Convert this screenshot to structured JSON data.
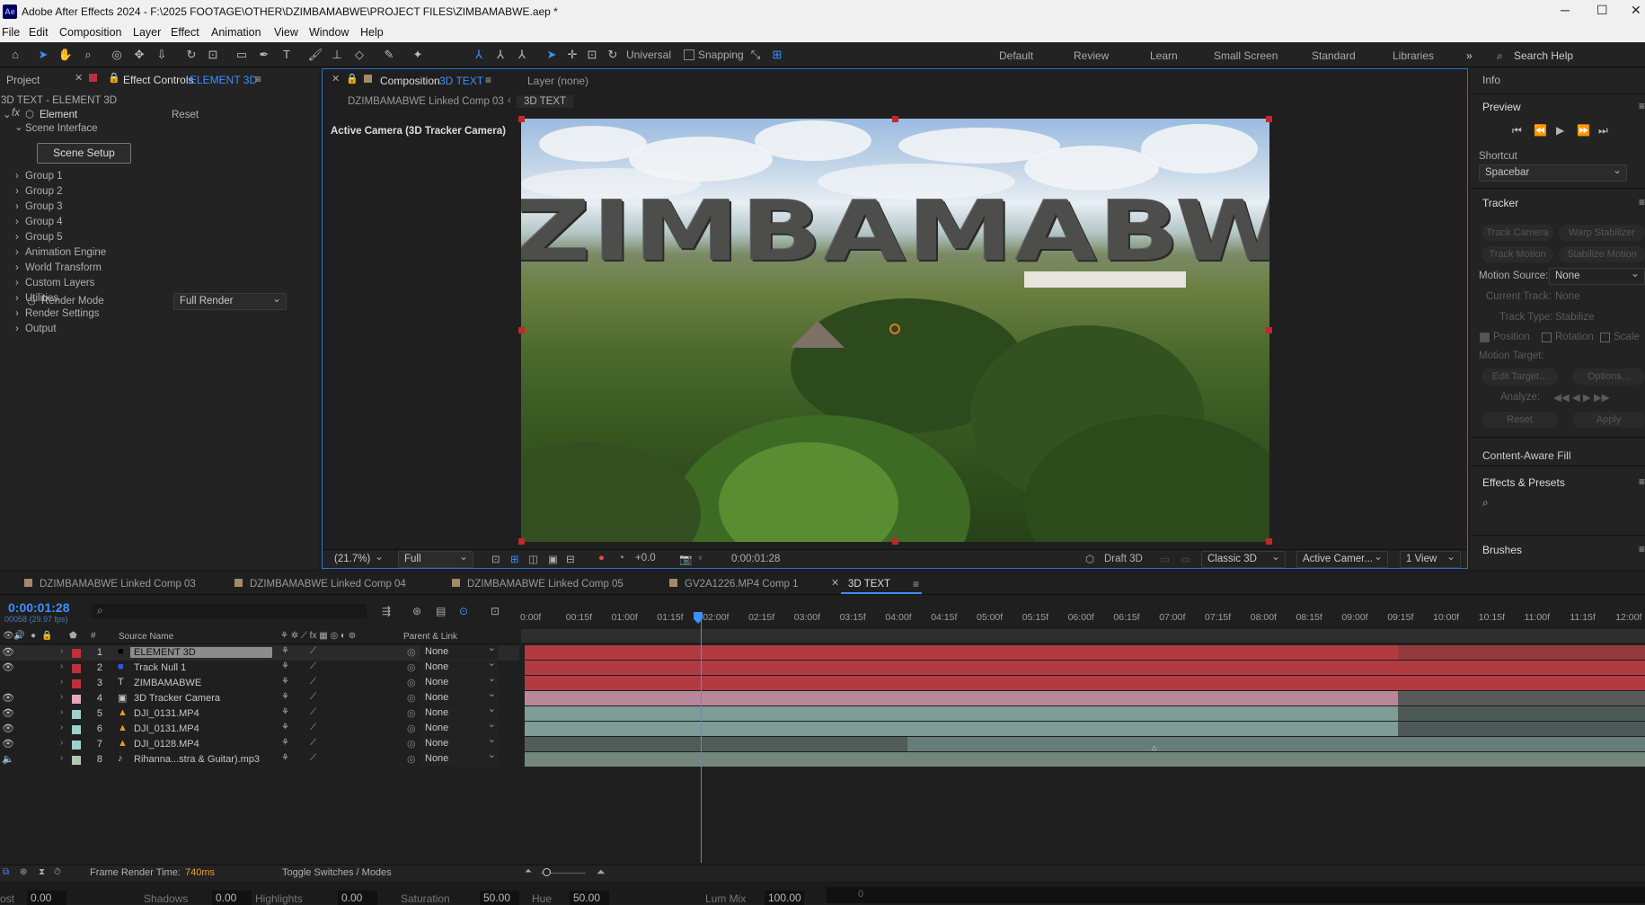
{
  "window": {
    "title": "Adobe After Effects 2024 - F:\\2025 FOOTAGE\\OTHER\\DZIMBAMABWE\\PROJECT FILES\\ZIMBAMABWE.aep *"
  },
  "menu": [
    "File",
    "Edit",
    "Composition",
    "Layer",
    "Effect",
    "Animation",
    "View",
    "Window",
    "Help"
  ],
  "toolbar": {
    "axis_mode": "Universal",
    "snapping": "Snapping"
  },
  "workspaces": [
    "Default",
    "Review",
    "Learn",
    "Small Screen",
    "Standard",
    "Libraries"
  ],
  "search": {
    "placeholder": "Search Help"
  },
  "left_panel": {
    "tab_project": "Project",
    "tab_effect_controls": "Effect Controls",
    "effect_layer": "ELEMENT 3D",
    "breadcrumb": "3D TEXT - ELEMENT 3D",
    "effect_name": "Element",
    "reset": "Reset",
    "scene_interface": "Scene Interface",
    "scene_setup": "Scene Setup",
    "groups": [
      "Group 1",
      "Group 2",
      "Group 3",
      "Group 4",
      "Group 5",
      "Animation Engine",
      "World Transform",
      "Custom Layers",
      "Utilities",
      "Render Settings",
      "Output"
    ],
    "render_mode_label": "Render Mode",
    "render_mode_value": "Full Render"
  },
  "comp_panel": {
    "tab_label": "Composition",
    "tab_comp": "3D TEXT",
    "layer_tab": "Layer (none)",
    "crumb_parent": "DZIMBAMABWE Linked Comp 03",
    "crumb_active": "3D TEXT",
    "camera_label": "Active Camera (3D Tracker Camera)",
    "overlay_text": "ZIMBAMABWE",
    "zoom": "(21.7%)",
    "resolution": "Full",
    "exposure": "+0.0",
    "timecode": "0:00:01:28",
    "draft": "Draft 3D",
    "renderer": "Classic 3D",
    "view": "Active Camer...",
    "views": "1 View"
  },
  "right_panel": {
    "info": "Info",
    "preview": "Preview",
    "shortcut_label": "Shortcut",
    "shortcut_value": "Spacebar",
    "tracker": "Tracker",
    "track_camera": "Track Camera",
    "warp_stabilizer": "Warp Stabilizer",
    "track_motion": "Track Motion",
    "stabilize_motion": "Stabilize Motion",
    "motion_source_label": "Motion Source:",
    "motion_source_value": "None",
    "current_track_label": "Current Track:",
    "current_track_value": "None",
    "track_type_label": "Track Type:",
    "track_type_value": "Stabilize",
    "position": "Position",
    "rotation": "Rotation",
    "scale": "Scale",
    "motion_target": "Motion Target:",
    "edit_target": "Edit Target...",
    "options": "Options...",
    "analyze": "Analyze:",
    "reset": "Reset",
    "apply": "Apply",
    "content_aware_fill": "Content-Aware Fill",
    "effects_presets": "Effects & Presets",
    "brushes": "Brushes"
  },
  "timeline": {
    "tabs": [
      "DZIMBAMABWE Linked Comp 03",
      "DZIMBAMABWE Linked Comp 04",
      "DZIMBAMABWE Linked Comp 05",
      "GV2A1226.MP4 Comp 1",
      "3D TEXT"
    ],
    "timecode": "0:00:01:28",
    "frame_info": "00058 (29.97 fps)",
    "col_source": "Source Name",
    "col_parent": "Parent & Link",
    "ruler": [
      "0:00f",
      "00:15f",
      "01:00f",
      "01:15f",
      "02:00f",
      "02:15f",
      "03:00f",
      "03:15f",
      "04:00f",
      "04:15f",
      "05:00f",
      "05:15f",
      "06:00f",
      "06:15f",
      "07:00f",
      "07:15f",
      "08:00f",
      "08:15f",
      "09:00f",
      "09:15f",
      "10:00f",
      "10:15f",
      "11:00f",
      "11:15f",
      "12:00f"
    ],
    "layers": [
      {
        "num": "1",
        "name": "ELEMENT 3D",
        "type": "■",
        "label": "#c0303a",
        "parent": "None",
        "selected": true
      },
      {
        "num": "2",
        "name": "Track Null 1",
        "type": "■",
        "label": "#c0303a",
        "parent": "None"
      },
      {
        "num": "3",
        "name": "ZIMBAMABWE",
        "type": "T",
        "label": "#c0303a",
        "parent": "None"
      },
      {
        "num": "4",
        "name": "3D Tracker Camera",
        "type": "▣",
        "label": "#e6a6c0",
        "parent": "None"
      },
      {
        "num": "5",
        "name": "DJI_0131.MP4",
        "type": "▲",
        "label": "#9fd1cc",
        "parent": "None"
      },
      {
        "num": "6",
        "name": "DJI_0131.MP4",
        "type": "▲",
        "label": "#9fd1cc",
        "parent": "None"
      },
      {
        "num": "7",
        "name": "DJI_0128.MP4",
        "type": "▲",
        "label": "#9fd1cc",
        "parent": "None"
      },
      {
        "num": "8",
        "name": "Rihanna...stra & Guitar).mp3",
        "type": "♪",
        "label": "#b0c8b0",
        "parent": "None"
      }
    ],
    "footer_render_label": "Frame Render Time:",
    "footer_render_value": "740ms",
    "toggle_label": "Toggle Switches / Modes"
  },
  "bottom_strip": [
    {
      "label": "ost",
      "value": "0.00"
    },
    {
      "label": "Shadows",
      "value": "0.00"
    },
    {
      "label": "Highlights",
      "value": "0.00"
    },
    {
      "label": "Saturation",
      "value": "50.00"
    },
    {
      "label": "Hue",
      "value": "50.00"
    },
    {
      "label": "Lum Mix",
      "value": "100.00"
    }
  ],
  "bottom_strip_end": "0",
  "colors": {
    "accent": "#3d8fff",
    "highlight_orange": "#f09a2a",
    "layer_red": "#b23b42",
    "layer_pink": "#b8889a",
    "layer_teal": "#7f9c96"
  }
}
